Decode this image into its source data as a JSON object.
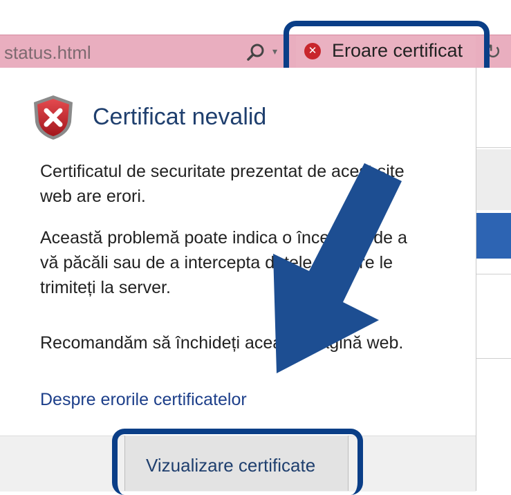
{
  "browser": {
    "url": "status.html",
    "cert_error_label": "Eroare certificat",
    "cert_error_icon": "error-x-icon",
    "accent_color": "#0a3e87",
    "address_bar_color": "#e9aebf"
  },
  "popup": {
    "title": "Certificat nevalid",
    "icon": "shield-error-icon",
    "paragraph_1": "Certificatul de securitate prezentat de acest site web are erori.",
    "paragraph_2": "Această problemă poate indica o încercare de a vă păcăli sau de a intercepta datele pe care le trimiteți la server.",
    "paragraph_3": "Recomandăm să închideți această pagină web.",
    "help_link": "Despre erorile certificatelor",
    "view_button": "Vizualizare certificate"
  }
}
